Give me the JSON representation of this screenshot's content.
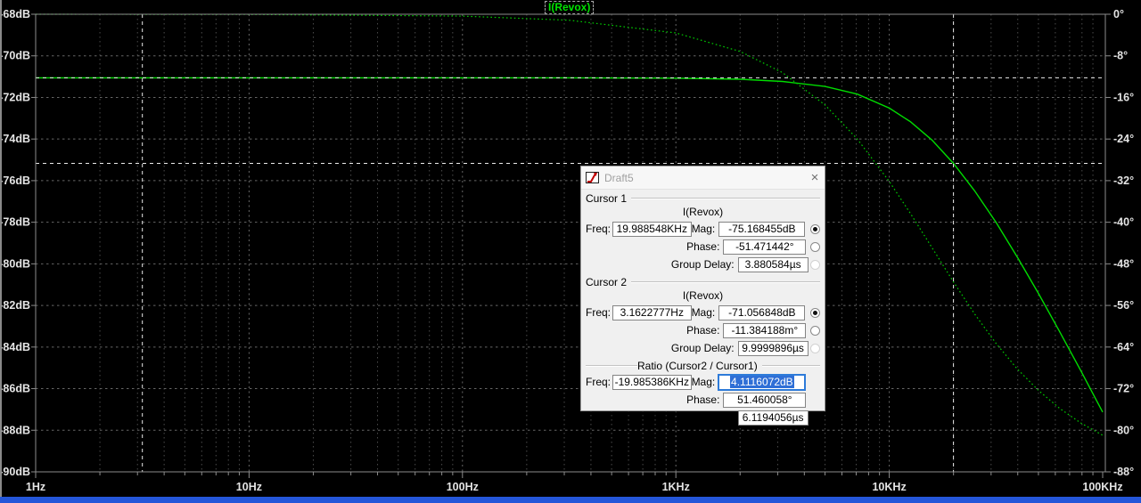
{
  "window": {
    "left_edge_color": "#8a8a8a",
    "bottom_bar_color": "#2456d9",
    "background": "#000000"
  },
  "plot": {
    "trace_label": "I(Revox)",
    "colors": {
      "trace_green": "#00dc00",
      "grid_minor": "#4b4b4b",
      "grid_major": "#666666",
      "border": "#8c8c8c",
      "cursor_line": "#ececec",
      "axis_text": "#e4e4e4"
    },
    "chart_data": {
      "type": "line",
      "title": "I(Revox)",
      "x_axis": {
        "scale": "log",
        "unit": "Hz",
        "min": 1,
        "max": 100000,
        "decade_labels": [
          "1Hz",
          "10Hz",
          "100Hz",
          "1KHz",
          "10KHz",
          "100KHz"
        ]
      },
      "y_left_axis": {
        "unit": "dB",
        "max": -68,
        "min": -90,
        "step": 2,
        "labels": [
          "-68dB",
          "-70dB",
          "-72dB",
          "-74dB",
          "-76dB",
          "-78dB",
          "-80dB",
          "-82dB",
          "-84dB",
          "-86dB",
          "-88dB",
          "-90dB"
        ]
      },
      "y_right_axis": {
        "unit": "degrees",
        "max": 0,
        "min": -88,
        "step": 8,
        "labels": [
          "0°",
          "-8°",
          "-16°",
          "-24°",
          "-32°",
          "-40°",
          "-48°",
          "-56°",
          "-64°",
          "-72°",
          "-80°",
          "-88°"
        ]
      },
      "series": [
        {
          "name": "I(Revox) magnitude",
          "axis": "left",
          "line_style": "solid",
          "color": "#00dc00",
          "freq_hz": [
            1,
            3.1622777,
            10,
            100,
            316,
            1000,
            2000,
            3162,
            5000,
            7079,
            10000,
            12589,
            15849,
            19988.5,
            25119,
            31623,
            39811,
            50119,
            63096,
            79433,
            100000
          ],
          "values_db": [
            -71.057,
            -71.057,
            -71.057,
            -71.057,
            -71.058,
            -71.074,
            -71.125,
            -71.23,
            -71.47,
            -71.84,
            -72.51,
            -73.17,
            -74.05,
            -75.168,
            -76.49,
            -78.0,
            -79.67,
            -81.44,
            -83.29,
            -85.19,
            -87.13
          ]
        },
        {
          "name": "I(Revox) phase",
          "axis": "right",
          "line_style": "dotted",
          "color": "#00cc00",
          "freq_hz": [
            1,
            3.1622777,
            10,
            100,
            316,
            1000,
            2000,
            3162,
            5000,
            7079,
            10000,
            12589,
            15849,
            19988.5,
            25119,
            31623,
            39811,
            50119,
            63096,
            79433,
            100000
          ],
          "values_deg": [
            -0.004,
            -0.0114,
            -0.036,
            -0.36,
            -1.14,
            -3.6,
            -7.16,
            -11.23,
            -17.44,
            -23.98,
            -32.15,
            -38.35,
            -44.88,
            -51.47,
            -57.64,
            -63.28,
            -68.21,
            -72.38,
            -75.84,
            -78.67,
            -80.96
          ]
        }
      ],
      "cursors": [
        {
          "name": "cursor1",
          "freq_hz": 19988.548,
          "mag_db": -75.168455
        },
        {
          "name": "cursor2",
          "freq_hz": 3.1622777,
          "mag_db": -71.056848
        }
      ],
      "grid": "log-dashed"
    }
  },
  "dialog": {
    "title": "Draft5",
    "close_label": "×",
    "labels": {
      "freq": "Freq:",
      "mag": "Mag:",
      "phase": "Phase:",
      "group_delay": "Group Delay:"
    },
    "cursor1": {
      "header": "Cursor 1",
      "trace": "I(Revox)",
      "freq": "19.988548KHz",
      "mag": "-75.168455dB",
      "phase": "-51.471442°",
      "group_delay": "3.880584µs"
    },
    "cursor2": {
      "header": "Cursor 2",
      "trace": "I(Revox)",
      "freq": "3.1622777Hz",
      "mag": "-71.056848dB",
      "phase": "-11.384188m°",
      "group_delay": "9.9999896µs"
    },
    "ratio": {
      "header": "Ratio (Cursor2 / Cursor1)",
      "freq": "-19.985386KHz",
      "mag": "4.1116072dB",
      "phase": "51.460058°",
      "group_delay": "6.1194056µs"
    }
  }
}
